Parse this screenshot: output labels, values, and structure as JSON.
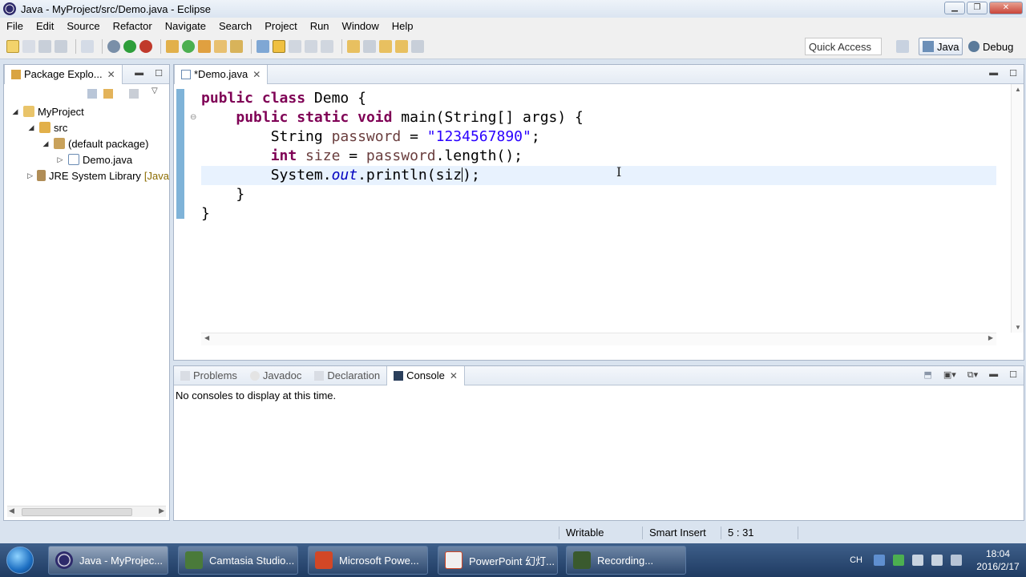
{
  "window": {
    "title": "Java - MyProject/src/Demo.java - Eclipse"
  },
  "menu": [
    "File",
    "Edit",
    "Source",
    "Refactor",
    "Navigate",
    "Search",
    "Project",
    "Run",
    "Window",
    "Help"
  ],
  "toolbar": {
    "quick_access": "Quick Access",
    "perspective_java": "Java",
    "perspective_debug": "Debug"
  },
  "package_explorer": {
    "tab_label": "Package Explo...",
    "tree": {
      "project": "MyProject",
      "src": "src",
      "package": "(default package)",
      "file": "Demo.java",
      "library": "JRE System Library",
      "library_suffix": "[Java"
    }
  },
  "editor": {
    "tab_label": "*Demo.java",
    "code": {
      "l1_kw1": "public",
      "l1_kw2": "class",
      "l1_rest": " Demo {",
      "l2_kw1": "public",
      "l2_kw2": "static",
      "l2_kw3": "void",
      "l2_rest": " main(String[] args) {",
      "l3_type": "String ",
      "l3_var": "password",
      "l3_eq": " = ",
      "l3_str": "\"1234567890\"",
      "l3_end": ";",
      "l4_kw": "int",
      "l4_var": " size",
      "l4_eq": " = ",
      "l4_var2": "password",
      "l4_rest": ".length();",
      "l5_a": "System.",
      "l5_field": "out",
      "l5_b": ".println(siz",
      "l5_c": ");",
      "l6": "}",
      "l7": "}"
    }
  },
  "bottom_panel": {
    "tabs": [
      "Problems",
      "Javadoc",
      "Declaration",
      "Console"
    ],
    "message": "No consoles to display at this time."
  },
  "status": {
    "writable": "Writable",
    "insert_mode": "Smart Insert",
    "position": "5 : 31"
  },
  "taskbar": {
    "items": [
      "Java - MyProjec...",
      "Camtasia Studio...",
      "Microsoft Powe...",
      "PowerPoint 幻灯...",
      "Recording..."
    ],
    "lang": "CH",
    "time": "18:04",
    "date": "2016/2/17"
  }
}
